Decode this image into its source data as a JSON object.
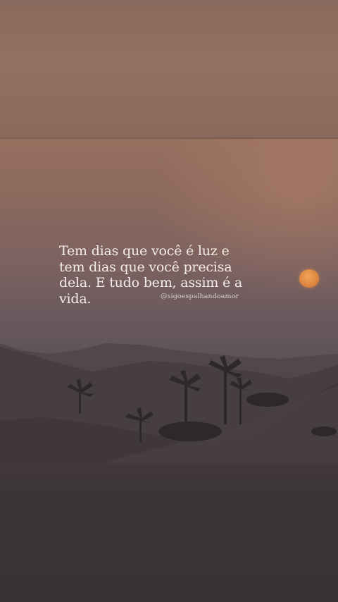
{
  "quote": {
    "lines": [
      "Tem dias que você é luz e",
      "tem dias que você precisa",
      "dela. E tudo bem, assim é a",
      "vida."
    ],
    "handle": "@sigoespalhandoamor"
  },
  "scene": {
    "subject": "desert-dunes-with-palm-trees-at-sunset",
    "colors": {
      "sky_top": "#96705f",
      "sky_bottom": "#5b5158",
      "dunes": "#3c3536",
      "sun": "#de8540",
      "text": "#f3ece8"
    }
  }
}
